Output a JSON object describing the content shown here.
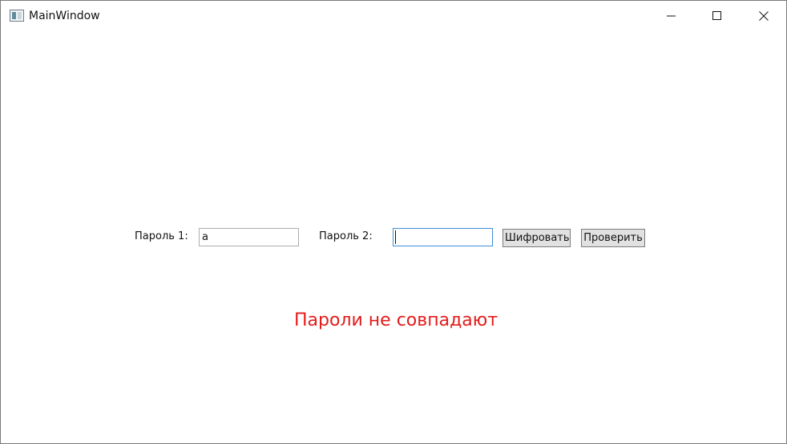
{
  "window": {
    "title": "MainWindow",
    "icon": "app-window-icon",
    "controls": {
      "minimize_icon": "minimize-icon",
      "maximize_icon": "maximize-icon",
      "close_icon": "close-icon"
    }
  },
  "form": {
    "password1_label": "Пароль 1:",
    "password1_value": "a",
    "password2_label": "Пароль 2:",
    "password2_value": "",
    "encrypt_label": "Шифровать",
    "check_label": "Проверить"
  },
  "status": {
    "message": "Пароли не совпадают",
    "color": "#e31b1b"
  },
  "colors": {
    "focus_border": "#3f8fd6",
    "button_face": "#e1e1e1"
  }
}
